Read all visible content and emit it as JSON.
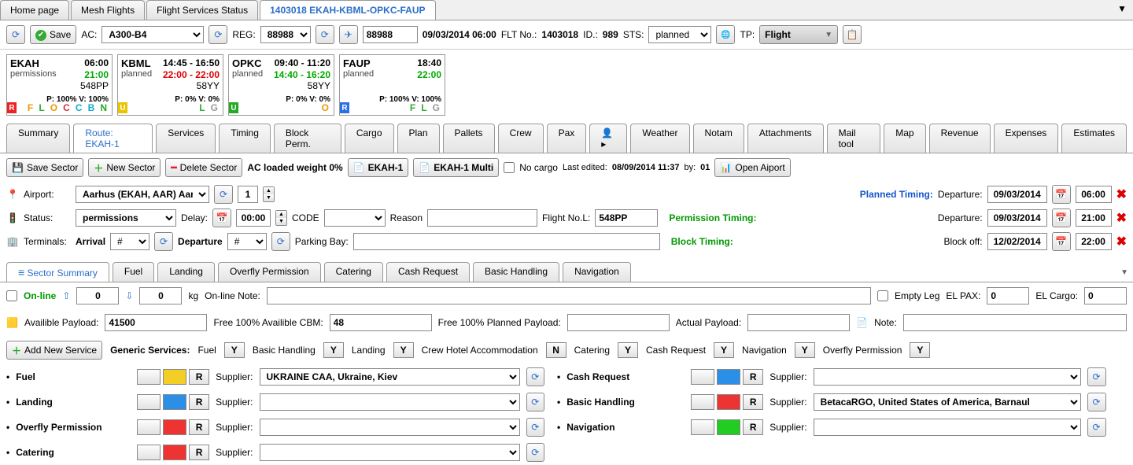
{
  "tabs": {
    "home": "Home page",
    "mesh": "Mesh Flights",
    "fss": "Flight Services Status",
    "flight": "1403018 EKAH-KBML-OPKC-FAUP"
  },
  "toolbar": {
    "save": "Save",
    "ac_lbl": "AC:",
    "ac": "A300-B4",
    "reg_lbl": "REG:",
    "reg": "88988",
    "reg2": "88988",
    "date": "09/03/2014 06:00",
    "fltno_lbl": "FLT No.:",
    "fltno": "1403018",
    "id_lbl": "ID.:",
    "id": "989",
    "sts_lbl": "STS:",
    "sts": "planned",
    "tp_lbl": "TP:",
    "tp": "Flight"
  },
  "legs": [
    {
      "code": "EKAH",
      "t1": "06:00",
      "status": "permissions",
      "t2": "21:00",
      "fno": "548PP",
      "pv": "P: 100% V: 100%",
      "sq": "R",
      "sqc": "#e22",
      "ltrs": "<span style='color:#e90'>F</span> <span style='color:#3a3'>L</span> <span style='color:#e90'>O</span> <span style='color:#c33'>C</span> <span style='color:#1ac'>C</span> <span style='color:#1ac'>B</span> <span style='color:#2a2'>N</span>"
    },
    {
      "code": "KBML",
      "t1": "14:45 - 16:50",
      "status": "planned",
      "t2": "22:00 - 22:00",
      "t2c": "red",
      "fno": "58YY",
      "pv": "P: 0% V: 0%",
      "sq": "U",
      "sqc": "#e9c400",
      "ltrs": "<span style='color:#3a3'>L</span> <span style='color:#999'>G</span>"
    },
    {
      "code": "OPKC",
      "t1": "09:40 - 11:20",
      "status": "planned",
      "t2": "14:40 - 16:20",
      "fno": "58YY",
      "pv": "P: 0% V: 0%",
      "sq": "U",
      "sqc": "#2a2",
      "ltrs": "<span style='color:#e90'>O</span>"
    },
    {
      "code": "FAUP",
      "t1": "18:40",
      "status": "planned",
      "t2": "22:00",
      "fno": "",
      "pv": "P: 100% V: 100%",
      "sq": "R",
      "sqc": "#2a6fe7",
      "ltrs": "<span style='color:#3a3'>F</span> <span style='color:#3a3'>L</span> <span style='color:#999'>G</span>"
    }
  ],
  "tab2": [
    "Summary",
    "Route: EKAH-1",
    "Services",
    "Timing",
    "Block Perm.",
    "Cargo",
    "Plan",
    "Pallets",
    "Crew",
    "Pax",
    "",
    "Weather",
    "Notam",
    "Attachments",
    "Mail tool",
    "Map",
    "Revenue",
    "Expenses",
    "Estimates"
  ],
  "tab2_active": 1,
  "midbar": {
    "save_sector": "Save Sector",
    "new_sector": "New Sector",
    "del_sector": "Delete Sector",
    "ac_weight": "AC loaded weight 0%",
    "ekah1": "EKAH-1",
    "ekah1m": "EKAH-1 Multi",
    "no_cargo": "No cargo",
    "last_edited_lbl": "Last edited:",
    "last_edited": "08/09/2014 11:37",
    "by_lbl": "by:",
    "by": "01",
    "open_airport": "Open Aiport"
  },
  "form": {
    "airport_lbl": "Airport:",
    "airport": "Aarhus (EKAH, AAR) Aarhu",
    "seq": "1",
    "status_lbl": "Status:",
    "status": "permissions",
    "delay_lbl": "Delay:",
    "delay": "00:00",
    "code_lbl": "CODE",
    "code": "",
    "reason_lbl": "Reason",
    "reason": "",
    "flno_lbl": "Flight No.L:",
    "flno": "548PP",
    "terminals_lbl": "Terminals:",
    "arrival_lbl": "Arrival",
    "arrival": "#",
    "departure_lbl": "Departure",
    "departure": "#",
    "parking_lbl": "Parking Bay:",
    "parking": "",
    "planned_timing": "Planned Timing:",
    "perm_timing": "Permission Timing:",
    "block_timing": "Block Timing:",
    "dep_lbl": "Departure:",
    "blockoff_lbl": "Block off:",
    "planned_date": "09/03/2014",
    "planned_time": "06:00",
    "perm_date": "09/03/2014",
    "perm_time": "21:00",
    "block_date": "12/02/2014",
    "block_time": "22:00"
  },
  "subtabs": [
    "Sector Summary",
    "Fuel",
    "Landing",
    "Overfly Permission",
    "Catering",
    "Cash Request",
    "Basic Handling",
    "Navigation"
  ],
  "subtab_active": 0,
  "sum": {
    "online": "On-line",
    "up": "0",
    "down": "0",
    "kg": "kg",
    "online_note_lbl": "On-line Note:",
    "empty_leg": "Empty Leg",
    "elpax_lbl": "EL PAX:",
    "elpax": "0",
    "elcargo_lbl": "EL Cargo:",
    "elcargo": "0",
    "avail_lbl": "Availible Payload:",
    "avail": "41500",
    "cbm_lbl": "Free 100% Availible CBM:",
    "cbm": "48",
    "planned_pl_lbl": "Free 100% Planned Payload:",
    "planned_pl": "",
    "actual_pl_lbl": "Actual Payload:",
    "actual_pl": "",
    "note_lbl": "Note:",
    "note": ""
  },
  "gensvc": {
    "add": "Add New Service",
    "lbl": "Generic Services:",
    "fuel": "Fuel",
    "bh": "Basic Handling",
    "landing": "Landing",
    "cha": "Crew Hotel Accommodation",
    "catering": "Catering",
    "cash": "Cash Request",
    "nav": "Navigation",
    "ofp": "Overfly Permission",
    "Y": "Y",
    "N": "N"
  },
  "svc": {
    "supplier": "Supplier:",
    "R": "R",
    "rows": [
      {
        "name": "Fuel",
        "color": "y",
        "sup": "UKRAINE CAA, Ukraine, Kiev"
      },
      {
        "name": "Landing",
        "color": "b",
        "sup": ""
      },
      {
        "name": "Overfly Permission",
        "color": "r",
        "sup": ""
      },
      {
        "name": "Catering",
        "color": "r",
        "sup": ""
      }
    ],
    "rows2": [
      {
        "name": "Cash Request",
        "color": "b",
        "sup": ""
      },
      {
        "name": "Basic Handling",
        "color": "r",
        "sup": "BetacaRGO, United States of America, Barnaul"
      },
      {
        "name": "Navigation",
        "color": "g",
        "sup": ""
      }
    ]
  }
}
